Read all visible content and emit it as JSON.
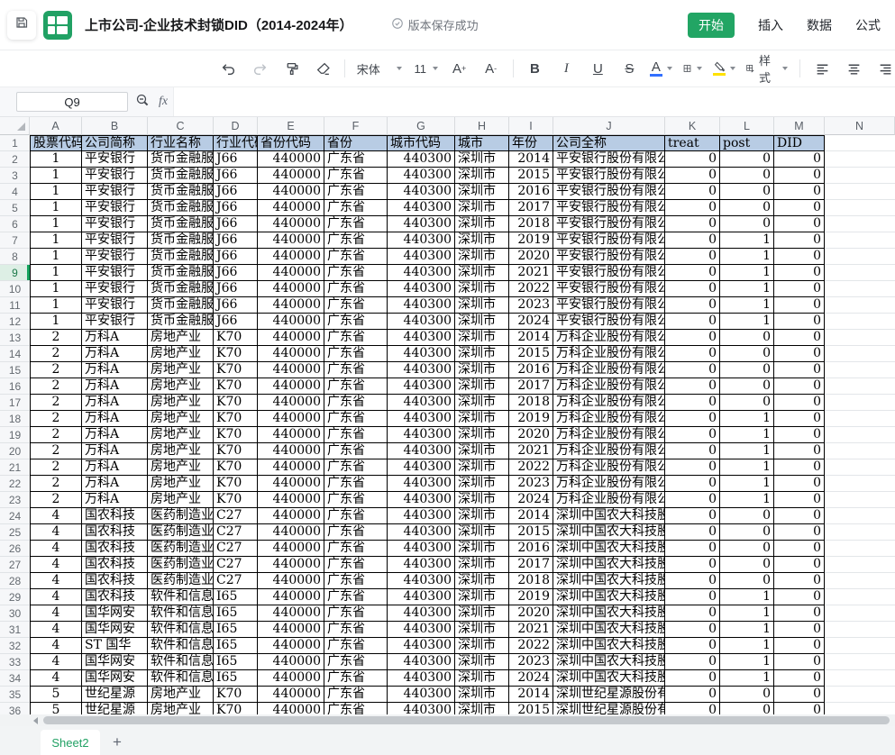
{
  "titlebar": {
    "doc_title": "上市公司-企业技术封锁DID（2014-2024年）",
    "save_status": "版本保存成功",
    "menu_tabs": [
      {
        "label": "开始",
        "active": true
      },
      {
        "label": "插入",
        "active": false
      },
      {
        "label": "数据",
        "active": false
      },
      {
        "label": "公式",
        "active": false
      }
    ]
  },
  "toolbar": {
    "font_name": "宋体",
    "font_size": "11",
    "font_inc_label": "A",
    "font_inc_sup": "+",
    "font_dec_label": "A",
    "font_dec_sup": "-",
    "bold_label": "B",
    "italic_label": "I",
    "underline_label": "U",
    "strikethrough_label": "S",
    "font_color_label": "A",
    "style_label": "样式"
  },
  "formula_bar": {
    "cell_ref": "Q9",
    "fx_label": "fx",
    "formula_value": ""
  },
  "sheet": {
    "column_letters": [
      "A",
      "B",
      "C",
      "D",
      "E",
      "F",
      "G",
      "H",
      "I",
      "J",
      "K",
      "L",
      "M",
      "N"
    ],
    "headers": [
      "股票代码",
      "公司简称",
      "行业名称",
      "行业代码",
      "省份代码",
      "省份",
      "城市代码",
      "城市",
      "年份",
      "公司全称",
      "treat",
      "post",
      "DID"
    ],
    "selected_cell": "Q9",
    "selected_row": 9,
    "rows": [
      [
        1,
        "平安银行",
        "货币金融服务",
        "J66",
        440000,
        "广东省",
        440300,
        "深圳市",
        2014,
        "平安银行股份有限公司",
        0,
        0,
        0
      ],
      [
        1,
        "平安银行",
        "货币金融服务",
        "J66",
        440000,
        "广东省",
        440300,
        "深圳市",
        2015,
        "平安银行股份有限公司",
        0,
        0,
        0
      ],
      [
        1,
        "平安银行",
        "货币金融服务",
        "J66",
        440000,
        "广东省",
        440300,
        "深圳市",
        2016,
        "平安银行股份有限公司",
        0,
        0,
        0
      ],
      [
        1,
        "平安银行",
        "货币金融服务",
        "J66",
        440000,
        "广东省",
        440300,
        "深圳市",
        2017,
        "平安银行股份有限公司",
        0,
        0,
        0
      ],
      [
        1,
        "平安银行",
        "货币金融服务",
        "J66",
        440000,
        "广东省",
        440300,
        "深圳市",
        2018,
        "平安银行股份有限公司",
        0,
        0,
        0
      ],
      [
        1,
        "平安银行",
        "货币金融服务",
        "J66",
        440000,
        "广东省",
        440300,
        "深圳市",
        2019,
        "平安银行股份有限公司",
        0,
        1,
        0
      ],
      [
        1,
        "平安银行",
        "货币金融服务",
        "J66",
        440000,
        "广东省",
        440300,
        "深圳市",
        2020,
        "平安银行股份有限公司",
        0,
        1,
        0
      ],
      [
        1,
        "平安银行",
        "货币金融服务",
        "J66",
        440000,
        "广东省",
        440300,
        "深圳市",
        2021,
        "平安银行股份有限公司",
        0,
        1,
        0
      ],
      [
        1,
        "平安银行",
        "货币金融服务",
        "J66",
        440000,
        "广东省",
        440300,
        "深圳市",
        2022,
        "平安银行股份有限公司",
        0,
        1,
        0
      ],
      [
        1,
        "平安银行",
        "货币金融服务",
        "J66",
        440000,
        "广东省",
        440300,
        "深圳市",
        2023,
        "平安银行股份有限公司",
        0,
        1,
        0
      ],
      [
        1,
        "平安银行",
        "货币金融服务",
        "J66",
        440000,
        "广东省",
        440300,
        "深圳市",
        2024,
        "平安银行股份有限公司",
        0,
        1,
        0
      ],
      [
        2,
        "万科A",
        "房地产业",
        "K70",
        440000,
        "广东省",
        440300,
        "深圳市",
        2014,
        "万科企业股份有限公司",
        0,
        0,
        0
      ],
      [
        2,
        "万科A",
        "房地产业",
        "K70",
        440000,
        "广东省",
        440300,
        "深圳市",
        2015,
        "万科企业股份有限公司",
        0,
        0,
        0
      ],
      [
        2,
        "万科A",
        "房地产业",
        "K70",
        440000,
        "广东省",
        440300,
        "深圳市",
        2016,
        "万科企业股份有限公司",
        0,
        0,
        0
      ],
      [
        2,
        "万科A",
        "房地产业",
        "K70",
        440000,
        "广东省",
        440300,
        "深圳市",
        2017,
        "万科企业股份有限公司",
        0,
        0,
        0
      ],
      [
        2,
        "万科A",
        "房地产业",
        "K70",
        440000,
        "广东省",
        440300,
        "深圳市",
        2018,
        "万科企业股份有限公司",
        0,
        0,
        0
      ],
      [
        2,
        "万科A",
        "房地产业",
        "K70",
        440000,
        "广东省",
        440300,
        "深圳市",
        2019,
        "万科企业股份有限公司",
        0,
        1,
        0
      ],
      [
        2,
        "万科A",
        "房地产业",
        "K70",
        440000,
        "广东省",
        440300,
        "深圳市",
        2020,
        "万科企业股份有限公司",
        0,
        1,
        0
      ],
      [
        2,
        "万科A",
        "房地产业",
        "K70",
        440000,
        "广东省",
        440300,
        "深圳市",
        2021,
        "万科企业股份有限公司",
        0,
        1,
        0
      ],
      [
        2,
        "万科A",
        "房地产业",
        "K70",
        440000,
        "广东省",
        440300,
        "深圳市",
        2022,
        "万科企业股份有限公司",
        0,
        1,
        0
      ],
      [
        2,
        "万科A",
        "房地产业",
        "K70",
        440000,
        "广东省",
        440300,
        "深圳市",
        2023,
        "万科企业股份有限公司",
        0,
        1,
        0
      ],
      [
        2,
        "万科A",
        "房地产业",
        "K70",
        440000,
        "广东省",
        440300,
        "深圳市",
        2024,
        "万科企业股份有限公司",
        0,
        1,
        0
      ],
      [
        4,
        "国农科技",
        "医药制造业",
        "C27",
        440000,
        "广东省",
        440300,
        "深圳市",
        2014,
        "深圳中国农大科技股份有限公司",
        0,
        0,
        0
      ],
      [
        4,
        "国农科技",
        "医药制造业",
        "C27",
        440000,
        "广东省",
        440300,
        "深圳市",
        2015,
        "深圳中国农大科技股份有限公司",
        0,
        0,
        0
      ],
      [
        4,
        "国农科技",
        "医药制造业",
        "C27",
        440000,
        "广东省",
        440300,
        "深圳市",
        2016,
        "深圳中国农大科技股份有限公司",
        0,
        0,
        0
      ],
      [
        4,
        "国农科技",
        "医药制造业",
        "C27",
        440000,
        "广东省",
        440300,
        "深圳市",
        2017,
        "深圳中国农大科技股份有限公司",
        0,
        0,
        0
      ],
      [
        4,
        "国农科技",
        "医药制造业",
        "C27",
        440000,
        "广东省",
        440300,
        "深圳市",
        2018,
        "深圳中国农大科技股份有限公司",
        0,
        0,
        0
      ],
      [
        4,
        "国农科技",
        "软件和信息技术服务业",
        "I65",
        440000,
        "广东省",
        440300,
        "深圳市",
        2019,
        "深圳中国农大科技股份有限公司",
        0,
        1,
        0
      ],
      [
        4,
        "国华网安",
        "软件和信息技术服务业",
        "I65",
        440000,
        "广东省",
        440300,
        "深圳市",
        2020,
        "深圳中国农大科技股份有限公司",
        0,
        1,
        0
      ],
      [
        4,
        "国华网安",
        "软件和信息技术服务业",
        "I65",
        440000,
        "广东省",
        440300,
        "深圳市",
        2021,
        "深圳中国农大科技股份有限公司",
        0,
        1,
        0
      ],
      [
        4,
        "ST 国华",
        "软件和信息技术服务业",
        "I65",
        440000,
        "广东省",
        440300,
        "深圳市",
        2022,
        "深圳中国农大科技股份有限公司",
        0,
        1,
        0
      ],
      [
        4,
        "国华网安",
        "软件和信息技术服务业",
        "I65",
        440000,
        "广东省",
        440300,
        "深圳市",
        2023,
        "深圳中国农大科技股份有限公司",
        0,
        1,
        0
      ],
      [
        4,
        "国华网安",
        "软件和信息技术服务业",
        "I65",
        440000,
        "广东省",
        440300,
        "深圳市",
        2024,
        "深圳中国农大科技股份有限公司",
        0,
        1,
        0
      ],
      [
        5,
        "世纪星源",
        "房地产业",
        "K70",
        440000,
        "广东省",
        440300,
        "深圳市",
        2014,
        "深圳世纪星源股份有限公司",
        0,
        0,
        0
      ],
      [
        5,
        "世纪星源",
        "房地产业",
        "K70",
        440000,
        "广东省",
        440300,
        "深圳市",
        2015,
        "深圳世纪星源股份有限公司",
        0,
        0,
        0
      ]
    ]
  },
  "tabbar": {
    "sheet_name": "Sheet2",
    "add_label": "+"
  },
  "colors": {
    "accent_green": "#22a564",
    "header_fill": "#b8cce4",
    "font_color_swatch": "#3370ff",
    "fill_color_swatch": "#ffe100",
    "selected_row_bar": "#15a35e"
  }
}
